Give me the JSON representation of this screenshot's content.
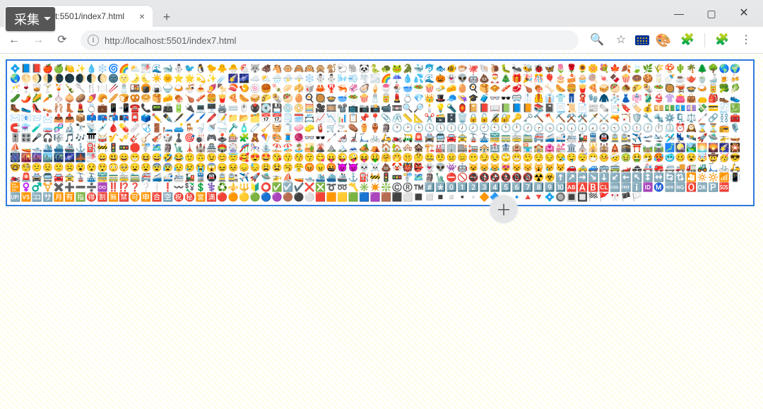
{
  "collect_label": "采集",
  "tab": {
    "title": "localhost:5501/index7.html",
    "close": "×"
  },
  "newtab": "+",
  "window": {
    "min": "—",
    "max": "▢",
    "close": "✕"
  },
  "nav": {
    "back": "←",
    "forward": "→",
    "reload": "⟳"
  },
  "omnibox": {
    "info": "i",
    "url": "http://localhost:5501/index7.html"
  },
  "right": {
    "search": "🔍",
    "star": "☆",
    "ext": "🧩",
    "menu": "⋮",
    "paint": "🎨"
  },
  "cursor": "＋",
  "emoji": "💠📘📕🍎🍏🍋✨💧❄️🌀🌈⛅🌁🌊🐋⛄🐦🐧🐤🐥🐣🐔🐺🐗🐴🐵🙈🙉🙊🐒🐑🐘🐼🐍🐢🐸🐊🐳🐬🐟🐠🐡🐙🐚🐌🐛🐜🐝🐞🦋🌷🌹🌻🌼💐🍁🍂🍃🌿🌾🍄🌵🌴🌲🌳🌎🌍🌏🌕🌖🌗🌘🌑🌒🌓🌔🌚🌝🌛🌜☀️🌞⭐🌟💫✨☄️🌠🌌☁️⛅🌧️⛈️🌩️❄️☃️⛄🌬️💨🌪️🌫️🌈☔💧💦🌊🎃👻👽🤖💩🎅🎄🎁🎉🎊🎈🎂🍰🧁🍭🍬🍫🍿🍩🍪🥛🍼☕🫖🍵🍶🍺🍻🥂🍷🥃🍸🍹🍾🥄🍴🍽️🥢🧂🍱🍘🍙🍚🍛🍜🍝🍠🍢🍣🍤🍥🥮🍡🥟🥠🥡🦀🦞🦐🦑🦪🍦🍧🍨🥣🥗🍿🧈🧀🥚🍳🥞🧇🥓🥩🍗🍖🦴🌭🍔🍟🍕🥪🥙🧆🌮🌯🥗🥘🫕🍲🍛🥫🥦🥬🥒🌶️🌽🥕🧄🧅🥔🍠🥐🥖🍞🥨🥯🥞🧀🍖🍗🥓🍔🍟🍕🌭🥪🌮🌯🥙🥚🍳🥘🍲🥣🥗🍿🧂🥫💄💍💎👑🎩🧢👒🎓🧳👓🕶️🥽🥼🦺👔👕👖🧣🧤🧥🧦👗👘🥻👙👚👛👜👝🎒👞👟🥾🥿👠👡🩰👢💄💍💼📱📲☎️📞📟📠🔋🔌💻🖥️🖨️⌨️🖱️🖲️💽💾💿📀🧮🎥🎞️📽️📺📷📸📹📼🔍🔎🕯️💡🔦🏮📔📕📖📗📘📙📚📓📃📜📄📰🗞️📑🔖🏷️💰💴💵💶💷💸💳🧾💹✉️📧📨📩📤📥📦📫📪📬📭📮🗳️✏️✒️🖋️🖊️🖌️🖍️📝📁📂🗂️📅📆🗒️🗓️📇📈📉📊📋📌📍📎🖇️📏📐✂️🗃️🗄️🗑️🔒🔓🔏🔐🔑🗝️🔨🪓⛏️⚒️🛠️🗡️⚔️🔫🏹🛡️🔧🔩⚙️🗜️⚖️🦯🔗⛓️🧰🧲⚗️🧪🧫🧬🔬🔭📡💉🩸💊🩹🩺🚪🛏️🛋️🪑🚽🚿🛁🪒🧴🧷🧹🧺🧻🧼🧽🧯🛒🚬⚰️⚱️🏺🗿🕐🕑🕒🕓🕔🕕🕖🕗🕘🕙🕚🕛🕜🕝🕞🕟🕠🕡🕢🕣🕤🕥🕦🕧⏱️⏲️⏰🕰️⌛⏳📻🎙️🎚️🎛️🎤🎧🎼🎵🎶🎹🥁🎷🎺🎸🪕🎻🎲♟️🎯🎳🎮🕹️🎰🧩🧸🪁🎨🧵🧶👓🕶️🦯🦽🦼🛴🚲🛵🏍️🛺🚨🚔🚍🚘🚖🚡🚠🚟🚃🚋🚞🚝🚄🚅🚈🚂🚆🚇🚊🚉✈️🛫🛬🛩️💺🛰️🚀🛸🚁🛶⛵🚤🛥️🛳️⛴️🚢⚓⛽🚧🚦🚥🛑🚏🗺️🗿🗽🗼🏰🏯🏟️🎡🎢🎠⛲⛱️🏖️🏝️🏜️🌋⛰️🏔️🗻🏕️⛺🏠🏡🏘️🏚️🏗️🏭🏢🏬🏣🏤🏥🏦🏨🏪🏫🏩💒🏛️⛪🕌🕍🛕🕋⛩️🛤️🛣️🗾🎑🏞️🌅🌄🌠🎇🎆🌇🌆🏙️🌃🌌🌉🌁😀😃😄😁😆😅🤣😂🙂🙃😉😊😇🥰😍🤩😘😗😚😙😋😛😜🤪😝🤑🤗🤭🤫🤔🤐🤨😐😑😶😏😒🙄😬🤥😌😔😪🤤😴😷🤒🤕🤢🤮🤧🥵🥶🥴😵🤯🤠🥳😎🤓🧐😕😟🙁☹️😮😯😲😳🥺😦😧😨😰😥😢😭😱😖😣😞😓😩😫🥱😤😡😠🤬😈👿💀☠️💩🤡👹👺👻👽👾🤖😺😸😹😻😼😽🙀😿😾🚗🚕🚙🚌🚎🏎️🚓🚑🚒🚐🚚🚛🚜🛴🚲🛵🏍️🚨🚔🚍🚘🚖🚡🚠🚟🚃🚋🚞🚝🚄🚅🚈🚂🚆🚇🚊🚉✈️🚀🛸🚁⛵🚤🛥️🛳️⛴️🚢⚓⛽🚧🚦🚥🚏🗺️🗿🗽⛔🚫🚭🚯🚱🚷📵🔞☢️☣️⬆️↗️➡️↘️⬇️↙️⬅️↖️↕️↔️🔄🔃🎦🔅🔆📶📳📴♀️♂️⚧️✖️➕➖➗♾️‼️⁉️❓❔❕❗〰️💱💲⚕️♻️⚜️🔱🔰⭕✅☑️✔️❌❎➰➿〽️✳️✴️❇️©️®️™️#️⃣*️⃣0️⃣1️⃣2️⃣3️⃣4️⃣5️⃣6️⃣7️⃣8️⃣9️⃣🔟🆎🅰️🅱️🆑🆒🆓ℹ️🆔Ⓜ️🆕🆖🅾️🆗🅿️🆘🆙🆚🈁🈂️🈷️🈶🈯🉐🈹🈚🈲🉑🈸🈴🈳㊗️㊙️🈺🈵🔴🟠🟡🟢🔵🟣🟤⚫⚪🟥🟧🟨🟩🟦🟪🟫⬛⬜◼️◻️◾◽▪️▫️🔶🔷🔸🔹🔺🔻💠🔘🔳🔲🏁🚩🎌🏴🏳️"
}
